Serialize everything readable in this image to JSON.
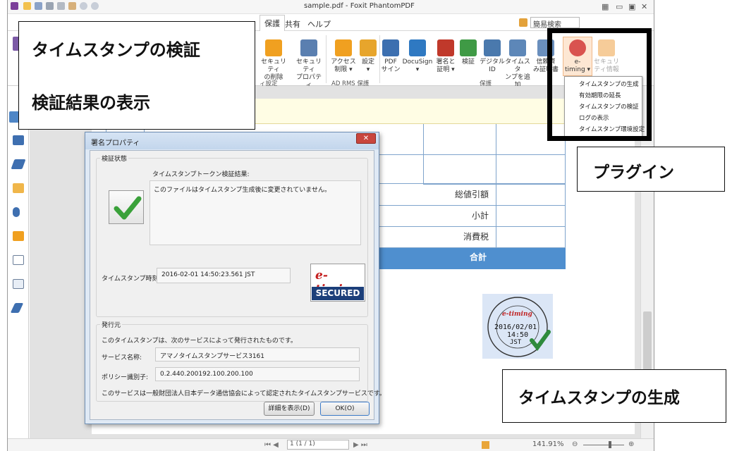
{
  "window": {
    "title": "sample.pdf - Foxit PhantomPDF",
    "quick_access_icons": [
      "app-logo-icon",
      "open-folder-icon",
      "save-icon",
      "print-icon",
      "scan-icon",
      "hand-icon",
      "undo-icon",
      "redo-icon"
    ]
  },
  "ribbon": {
    "tabs": [
      "保護",
      "共有",
      "ヘルプ"
    ],
    "search_value": "簡易検索",
    "buttons": [
      {
        "line1": "セキュリティ",
        "line2": "の削除"
      },
      {
        "line1": "セキュリティ",
        "line2": "プロパティ"
      },
      {
        "line1": "アクセス",
        "line2": "制限 ▾"
      },
      {
        "line1": "設定",
        "line2": "▾"
      },
      {
        "line1": "PDF",
        "line2": "サイン"
      },
      {
        "line1": "DocuSign",
        "line2": "▾"
      },
      {
        "line1": "署名と",
        "line2": "証明 ▾"
      },
      {
        "line1": "検証",
        "line2": ""
      },
      {
        "line1": "デジタル",
        "line2": "ID"
      },
      {
        "line1": "タイムスタ",
        "line2": "ンプを追加"
      },
      {
        "line1": "信頼済",
        "line2": "み証明書"
      },
      {
        "line1": "e-",
        "line2": "timing ▾"
      },
      {
        "line1": "セキュリ",
        "line2": "ティ情報"
      }
    ],
    "groups": [
      "ィ設定",
      "AD RMS 保護",
      "保護"
    ]
  },
  "dropdown": {
    "items": [
      "タイムスタンプの生成",
      "有効期限の延長",
      "タイムスタンプの検証",
      "ログの表示",
      "タイムスタンプ環境設定"
    ]
  },
  "invoice": {
    "rows": [
      "総値引額",
      "小計",
      "消費税",
      "合計"
    ]
  },
  "dialog": {
    "title": "署名プロパティ",
    "close_label": "✕",
    "status_group": "検証状態",
    "result_label": "タイムスタンプトークン検証結果:",
    "result_text": "このファイルはタイムスタンプ生成後に変更されていません。",
    "time_label": "タイムスタンプ時刻:",
    "time_value": "2016-02-01 14:50:23.561 JST",
    "logo_text": "e-timing",
    "logo_secured": "SECURED",
    "issuer_group": "発行元",
    "issuer_desc": "このタイムスタンプは、次のサービスによって発行されたものです。",
    "service_label": "サービス名称:",
    "service_value": "アマノタイムスタンプサービス3161",
    "policy_label": "ポリシー識別子:",
    "policy_value": "0.2.440.200192.100.200.100",
    "cert_note": "このサービスは一般財団法人日本データ通信協会によって認定されたタイムスタンプサービスです。",
    "details_button": "詳細を表示(D)",
    "ok_button": "OK(O)"
  },
  "stamp": {
    "date": "2016/02/01",
    "time": "14:50",
    "zone": "JST",
    "brand": "e-timing",
    "arc_top": "Amano Digital Time Stamp Service",
    "arc_bottom": "Time Stamp Auth"
  },
  "statusbar": {
    "page": "1 (1 / 1)",
    "zoom": "141.91%"
  },
  "callouts": {
    "verify": "タイムスタンプの検証",
    "results": "検証結果の表示",
    "plugin": "プラグイン",
    "generate": "タイムスタンプの生成"
  },
  "colors": {
    "total_row": "#4f8fcf",
    "plugin_highlight": "#000000",
    "accent_orange": "#f0a020"
  }
}
